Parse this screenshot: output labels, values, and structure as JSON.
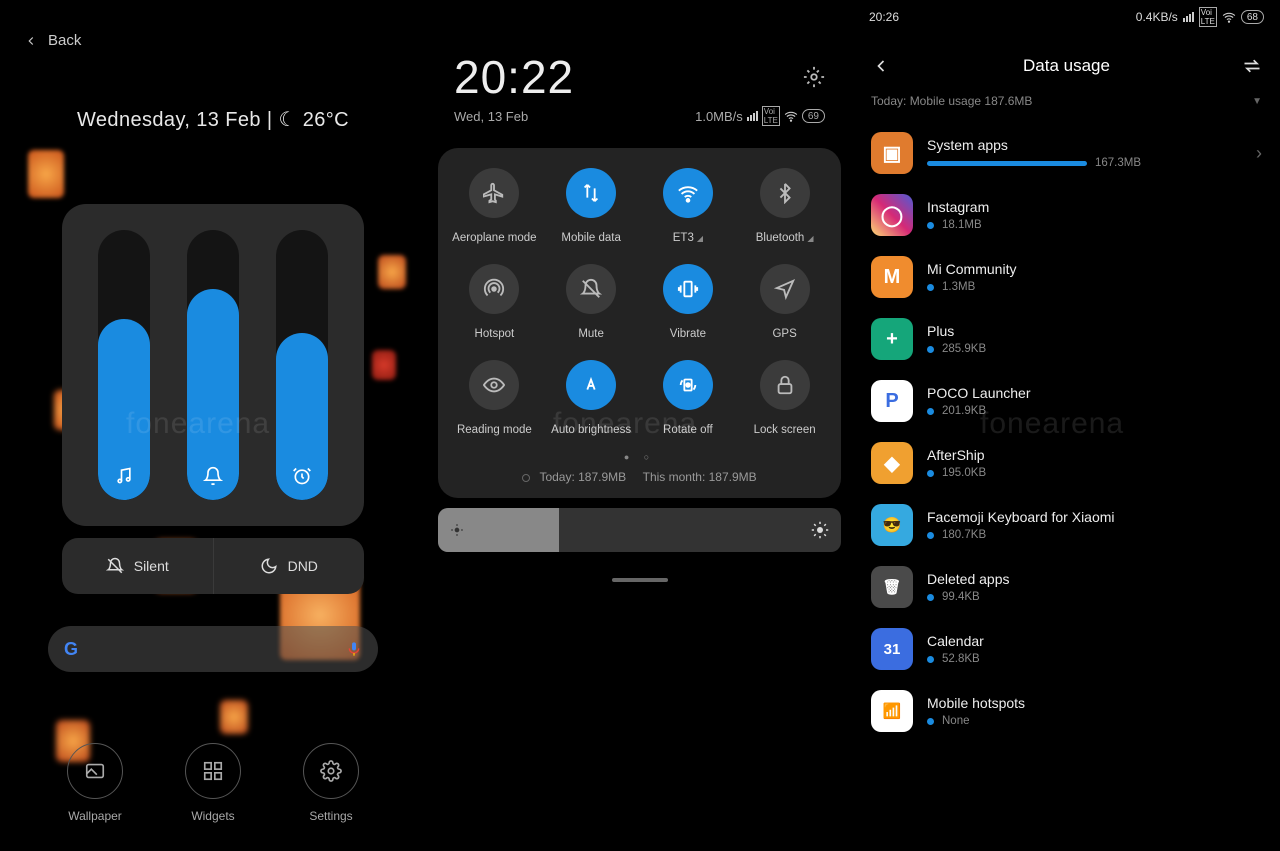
{
  "panel1": {
    "back_label": "Back",
    "weather": "Wednesday, 13 Feb  |  ☾  26°C",
    "sliders": [
      {
        "fill_pct": 67,
        "icon": "music"
      },
      {
        "fill_pct": 78,
        "icon": "bell"
      },
      {
        "fill_pct": 62,
        "icon": "alarm"
      }
    ],
    "mode_silent": "Silent",
    "mode_dnd": "DND",
    "dock": [
      {
        "label": "Wallpaper",
        "icon": "image"
      },
      {
        "label": "Widgets",
        "icon": "grid"
      },
      {
        "label": "Settings",
        "icon": "gear"
      }
    ]
  },
  "panel2": {
    "time": "20:22",
    "date": "Wed, 13 Feb",
    "speed": "1.0MB/s",
    "battery": "69",
    "tiles": [
      {
        "label": "Aeroplane mode",
        "on": false,
        "icon": "airplane",
        "arrow": false
      },
      {
        "label": "Mobile data",
        "on": true,
        "icon": "updown",
        "arrow": false
      },
      {
        "label": "ET3",
        "on": true,
        "icon": "wifi",
        "arrow": true
      },
      {
        "label": "Bluetooth",
        "on": false,
        "icon": "bluetooth",
        "arrow": true
      },
      {
        "label": "Hotspot",
        "on": false,
        "icon": "hotspot",
        "arrow": false
      },
      {
        "label": "Mute",
        "on": false,
        "icon": "mute",
        "arrow": false
      },
      {
        "label": "Vibrate",
        "on": true,
        "icon": "vibrate",
        "arrow": false
      },
      {
        "label": "GPS",
        "on": false,
        "icon": "gps",
        "arrow": false
      },
      {
        "label": "Reading mode",
        "on": false,
        "icon": "eye",
        "arrow": false
      },
      {
        "label": "Auto brightness",
        "on": true,
        "icon": "autoA",
        "arrow": false
      },
      {
        "label": "Rotate off",
        "on": true,
        "icon": "rotate",
        "arrow": false
      },
      {
        "label": "Lock screen",
        "on": false,
        "icon": "lock",
        "arrow": false
      }
    ],
    "usage_today": "Today: 187.9MB",
    "usage_month": "This month: 187.9MB"
  },
  "panel3": {
    "status_time": "20:26",
    "status_speed": "0.4KB/s",
    "status_battery": "68",
    "title": "Data usage",
    "summary": "Today: Mobile usage 187.6MB",
    "apps": [
      {
        "name": "System apps",
        "size": "167.3MB",
        "bar_pct": 100,
        "color": "#e07b2e",
        "glyph": "▣",
        "chevron": true
      },
      {
        "name": "Instagram",
        "size": "18.1MB",
        "bar_pct": 0,
        "color": "linear-gradient(45deg,#feda75,#d62976,#4f5bd5)",
        "glyph": "◯",
        "chevron": false
      },
      {
        "name": "Mi Community",
        "size": "1.3MB",
        "bar_pct": 0,
        "color": "#f08c2e",
        "glyph": "M",
        "chevron": false
      },
      {
        "name": "Plus",
        "size": "285.9KB",
        "bar_pct": 0,
        "color": "#15a67a",
        "glyph": "+",
        "chevron": false
      },
      {
        "name": "POCO Launcher",
        "size": "201.9KB",
        "bar_pct": 0,
        "color": "#fff",
        "glyph": "P",
        "chevron": false,
        "fg": "#3b6de0"
      },
      {
        "name": "AfterShip",
        "size": "195.0KB",
        "bar_pct": 0,
        "color": "#f0a030",
        "glyph": "◆",
        "chevron": false
      },
      {
        "name": "Facemoji Keyboard for Xiaomi",
        "size": "180.7KB",
        "bar_pct": 0,
        "color": "#35a9e0",
        "glyph": "😎",
        "chevron": false
      },
      {
        "name": "Deleted apps",
        "size": "99.4KB",
        "bar_pct": 0,
        "color": "#4a4a4a",
        "glyph": "🗑",
        "chevron": false
      },
      {
        "name": "Calendar",
        "size": "52.8KB",
        "bar_pct": 0,
        "color": "#3b6de0",
        "glyph": "31",
        "chevron": false
      },
      {
        "name": "Mobile hotspots",
        "size": "None",
        "bar_pct": 0,
        "color": "#fff",
        "glyph": "📶",
        "chevron": false,
        "fg": "#f0a030"
      }
    ]
  },
  "watermark": "fonearena"
}
